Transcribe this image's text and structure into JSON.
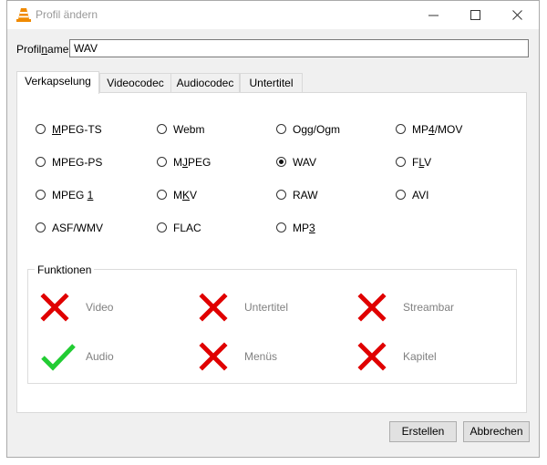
{
  "window": {
    "title": "Profil ändern"
  },
  "profile": {
    "label_pre": "Profil",
    "label_accel": "n",
    "label_post": "ame",
    "value": "WAV"
  },
  "tabs": [
    {
      "label": "Verkapselung",
      "active": true
    },
    {
      "label": "Videocodec",
      "active": false
    },
    {
      "label": "Audiocodec",
      "active": false
    },
    {
      "label": "Untertitel",
      "active": false
    }
  ],
  "formats": [
    {
      "pre": "",
      "accel": "M",
      "post": "PEG-TS",
      "checked": false
    },
    {
      "pre": "",
      "accel": "",
      "post": "Webm",
      "checked": false
    },
    {
      "pre": "",
      "accel": "",
      "post": "Ogg/Ogm",
      "checked": false
    },
    {
      "pre": "MP",
      "accel": "4",
      "post": "/MOV",
      "checked": false
    },
    {
      "pre": "",
      "accel": "",
      "post": "MPEG-PS",
      "checked": false
    },
    {
      "pre": "M",
      "accel": "J",
      "post": "PEG",
      "checked": false
    },
    {
      "pre": "",
      "accel": "",
      "post": "WAV",
      "checked": true
    },
    {
      "pre": "F",
      "accel": "L",
      "post": "V",
      "checked": false
    },
    {
      "pre": "MPEG ",
      "accel": "1",
      "post": "",
      "checked": false
    },
    {
      "pre": "M",
      "accel": "K",
      "post": "V",
      "checked": false
    },
    {
      "pre": "",
      "accel": "",
      "post": "RAW",
      "checked": false
    },
    {
      "pre": "",
      "accel": "",
      "post": "AVI",
      "checked": false
    },
    {
      "pre": "",
      "accel": "",
      "post": "ASF/WMV",
      "checked": false
    },
    {
      "pre": "",
      "accel": "",
      "post": "FLAC",
      "checked": false
    },
    {
      "pre": "MP",
      "accel": "3",
      "post": "",
      "checked": false
    }
  ],
  "features": {
    "title": "Funktionen",
    "items": [
      {
        "label": "Video",
        "supported": false,
        "icon": "cross-icon"
      },
      {
        "label": "Untertitel",
        "supported": false,
        "icon": "cross-icon"
      },
      {
        "label": "Streambar",
        "supported": false,
        "icon": "cross-icon"
      },
      {
        "label": "Audio",
        "supported": true,
        "icon": "check-icon"
      },
      {
        "label": "Menüs",
        "supported": false,
        "icon": "cross-icon"
      },
      {
        "label": "Kapitel",
        "supported": false,
        "icon": "cross-icon"
      }
    ]
  },
  "buttons": {
    "create": "Erstellen",
    "cancel": "Abbrechen"
  },
  "colors": {
    "cross": "#e00000",
    "check": "#22cc33",
    "disabled_text": "#808080"
  }
}
